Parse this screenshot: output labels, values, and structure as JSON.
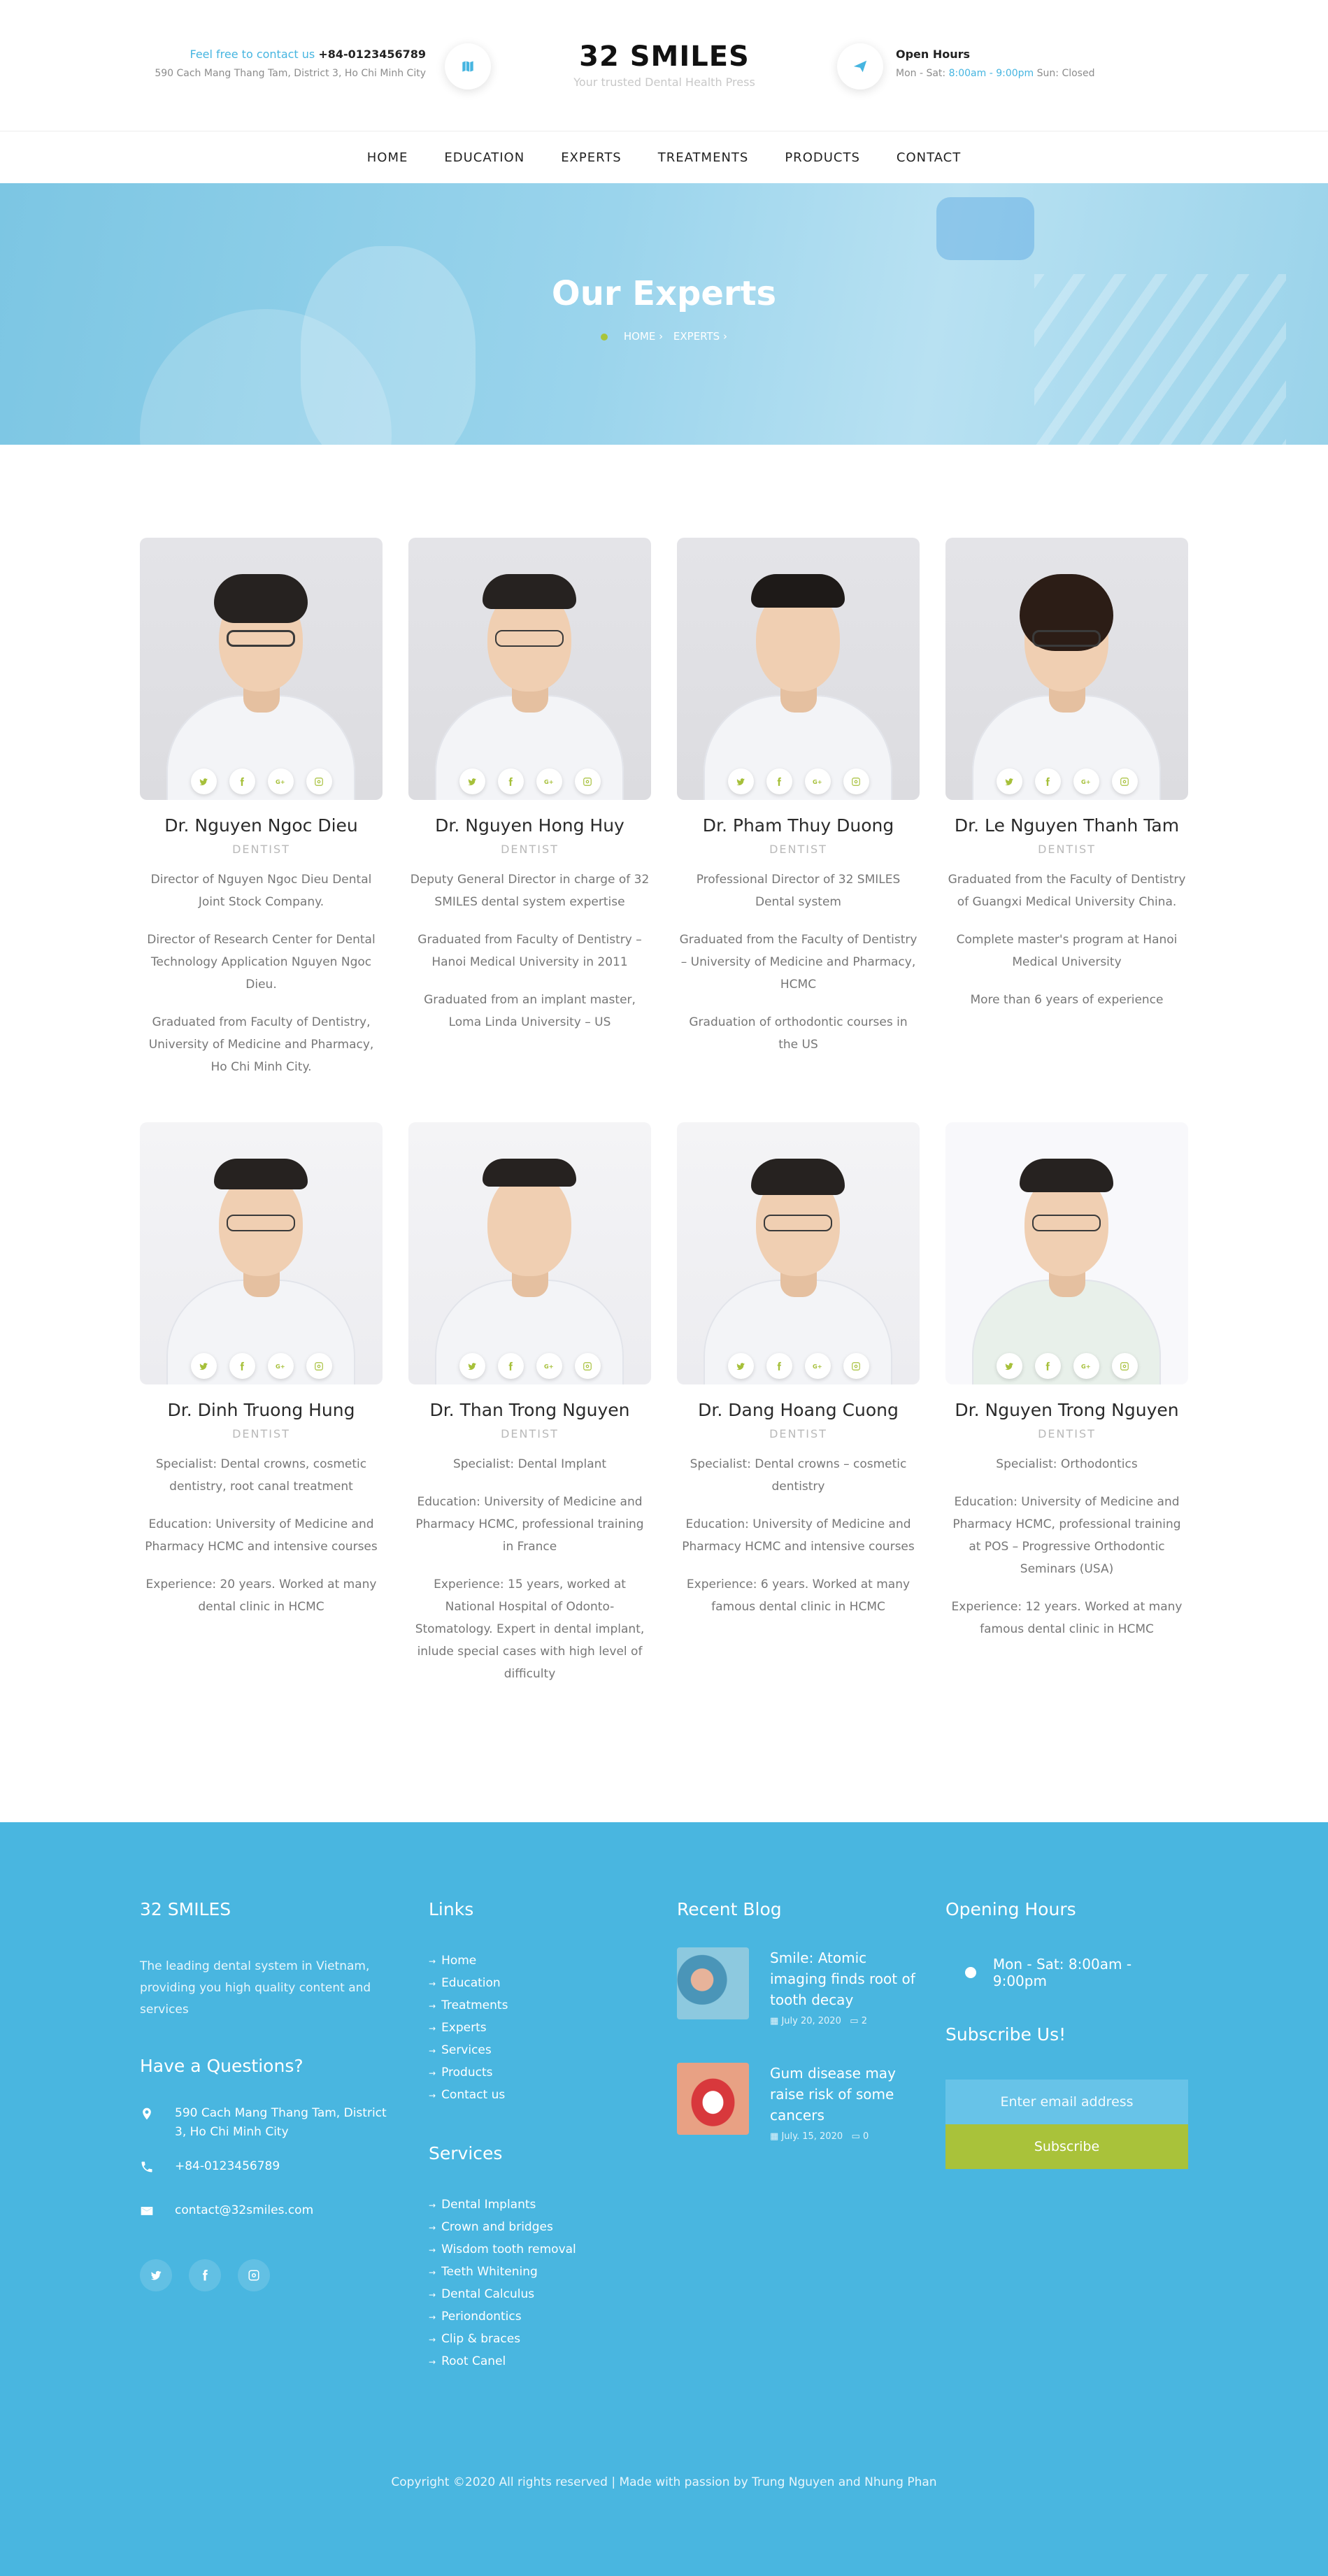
{
  "header": {
    "contact_lead": "Feel free to contact us",
    "contact_phone": "+84-0123456789",
    "address": "590 Cach Mang Thang Tam, District 3, Ho Chi Minh City",
    "brand_name": "32 SMILES",
    "brand_tagline": "Your trusted Dental Health Press",
    "hours_title": "Open Hours",
    "hours_days": "Mon - Sat:",
    "hours_time": "8:00am - 9:00pm",
    "hours_closed": "Sun: Closed",
    "map_icon": "map-icon",
    "send_icon": "paper-plane-icon"
  },
  "nav": {
    "items": [
      "HOME",
      "EDUCATION",
      "EXPERTS",
      "TREATMENTS",
      "PRODUCTS",
      "CONTACT"
    ]
  },
  "hero": {
    "title": "Our Experts",
    "crumb_home": "HOME",
    "crumb_current": "EXPERTS"
  },
  "experts": [
    {
      "name": "Dr. Nguyen Ngoc Dieu",
      "role": "DENTIST",
      "paragraphs": [
        "Director of Nguyen Ngoc Dieu Dental Joint Stock Company.",
        "Director of Research Center for Dental Technology Application Nguyen Ngoc Dieu.",
        "Graduated from Faculty of Dentistry, University of Medicine and Pharmacy, Ho Chi Minh City."
      ]
    },
    {
      "name": "Dr. Nguyen Hong Huy",
      "role": "DENTIST",
      "paragraphs": [
        "Deputy General Director in charge of 32 SMILES dental system expertise",
        "Graduated from Faculty of Dentistry – Hanoi Medical University in 2011",
        "Graduated from an implant master, Loma Linda University – US"
      ]
    },
    {
      "name": "Dr. Pham Thuy Duong",
      "role": "DENTIST",
      "paragraphs": [
        "Professional Director of 32 SMILES Dental system",
        "Graduated from the Faculty of Dentistry – University of Medicine and Pharmacy, HCMC",
        "Graduation of orthodontic courses in the US"
      ]
    },
    {
      "name": "Dr. Le Nguyen Thanh Tam",
      "role": "DENTIST",
      "paragraphs": [
        "Graduated from the Faculty of Dentistry of Guangxi Medical University China.",
        "Complete master's program at Hanoi Medical University",
        "More than 6 years of experience"
      ]
    },
    {
      "name": "Dr. Dinh Truong Hung",
      "role": "DENTIST",
      "paragraphs": [
        "Specialist: Dental crowns, cosmetic dentistry, root canal treatment",
        "Education: University of Medicine and Pharmacy HCMC and intensive courses",
        "Experience: 20 years. Worked at many dental clinic in HCMC"
      ]
    },
    {
      "name": "Dr. Than Trong Nguyen",
      "role": "DENTIST",
      "paragraphs": [
        "Specialist: Dental Implant",
        "Education: University of Medicine and Pharmacy HCMC, professional training in France",
        "Experience: 15 years, worked at National Hospital of Odonto-Stomatology. Expert in dental implant, inlude special cases with high level of difficulty"
      ]
    },
    {
      "name": "Dr. Dang Hoang Cuong",
      "role": "DENTIST",
      "paragraphs": [
        "Specialist: Dental crowns – cosmetic dentistry",
        "Education: University of Medicine and Pharmacy HCMC and intensive courses",
        "Experience: 6 years. Worked at many famous dental clinic in HCMC"
      ]
    },
    {
      "name": "Dr. Nguyen Trong Nguyen",
      "role": "DENTIST",
      "paragraphs": [
        "Specialist: Orthodontics",
        "Education: University of Medicine and Pharmacy HCMC, professional training at POS – Progressive Orthodontic Seminars (USA)",
        "Experience: 12 years. Worked at many famous dental clinic in HCMC"
      ]
    }
  ],
  "social_icons": [
    "twitter-icon",
    "facebook-icon",
    "google-plus-icon",
    "instagram-icon"
  ],
  "footer": {
    "about_title": "32 SMILES",
    "about_text": "The leading dental system in Vietnam, providing you high quality content and services",
    "questions_title": "Have a Questions?",
    "address": "590 Cach Mang Thang Tam, District 3, Ho Chi Minh City",
    "phone": "+84-0123456789",
    "email": "contact@32smiles.com",
    "links_title": "Links",
    "links": [
      "Home",
      "Education",
      "Treatments",
      "Experts",
      "Services",
      "Products",
      "Contact us"
    ],
    "services_title": "Services",
    "services": [
      "Dental Implants",
      "Crown and bridges",
      "Wisdom tooth removal",
      "Teeth Whitening",
      "Dental Calculus",
      "Periondontics",
      "Clip & braces",
      "Root Canel"
    ],
    "blog_title": "Recent Blog",
    "blog": [
      {
        "title": "Smile: Atomic imaging finds root of tooth decay",
        "date": "July 20, 2020",
        "comments": "2"
      },
      {
        "title": "Gum disease may raise risk of some cancers",
        "date": "July. 15, 2020",
        "comments": "0"
      }
    ],
    "opening_title": "Opening Hours",
    "opening_line": "Mon - Sat: 8:00am - 9:00pm",
    "subscribe_title": "Subscribe Us!",
    "subscribe_placeholder": "Enter email address",
    "subscribe_button": "Subscribe",
    "copyright": "Copyright ©2020 All rights reserved | Made with passion by Trung Nguyen and Nhung Phan"
  },
  "colors": {
    "accent_blue": "#49b6e0",
    "accent_green": "#a9c23a"
  }
}
